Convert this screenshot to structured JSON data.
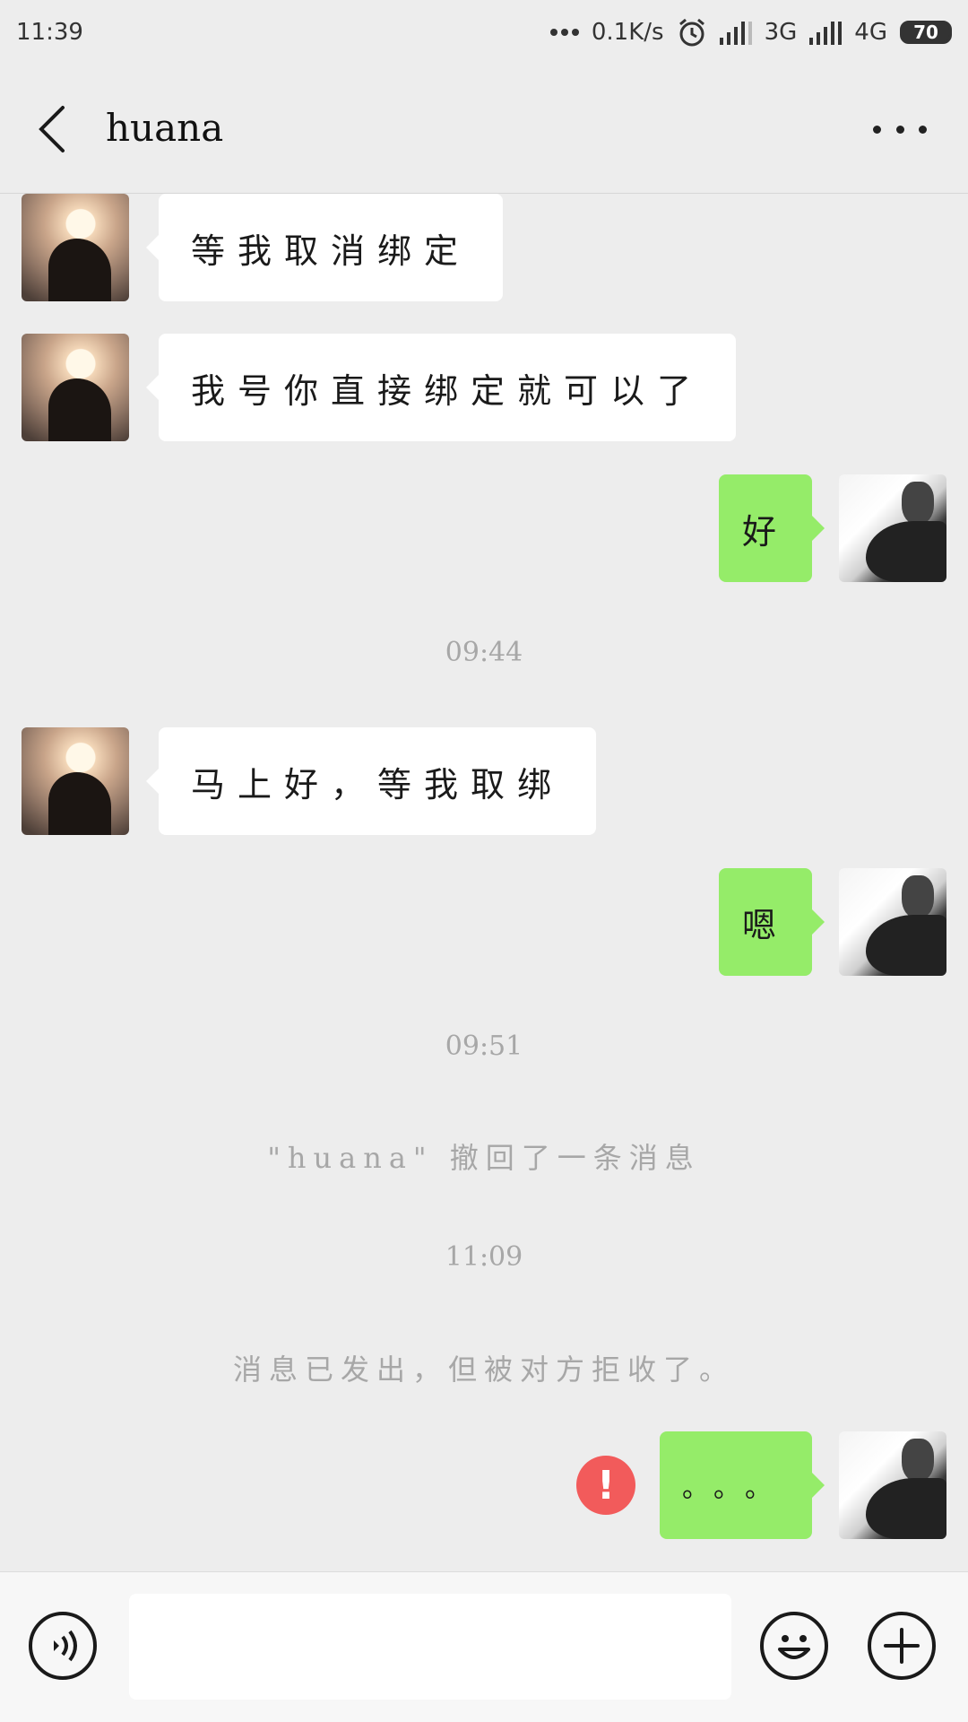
{
  "status_bar": {
    "time": "11:39",
    "net_speed": "0.1K/s",
    "network1": "3G",
    "network2": "4G",
    "battery": "70"
  },
  "header": {
    "title": "huana"
  },
  "messages": [
    {
      "side": "left",
      "text": "等我取消绑定"
    },
    {
      "side": "left",
      "text": "我号你直接绑定就可以了"
    },
    {
      "side": "right",
      "text": "好"
    },
    {
      "type": "time",
      "text": "09:44"
    },
    {
      "side": "left",
      "text": "马上好，等我取绑"
    },
    {
      "side": "right",
      "text": "嗯"
    },
    {
      "type": "time",
      "text": "09:51"
    },
    {
      "type": "system",
      "text": "\"huana\" 撤回了一条消息"
    },
    {
      "type": "time",
      "text": "11:09"
    },
    {
      "type": "system",
      "text": "消息已发出，但被对方拒收了。"
    },
    {
      "side": "right",
      "text": "。。。",
      "error": "!"
    }
  ],
  "input_bar": {
    "placeholder": ""
  },
  "colors": {
    "background": "#ededed",
    "bubble_right": "#95ec69",
    "bubble_left": "#ffffff",
    "error": "#f25b5b"
  }
}
